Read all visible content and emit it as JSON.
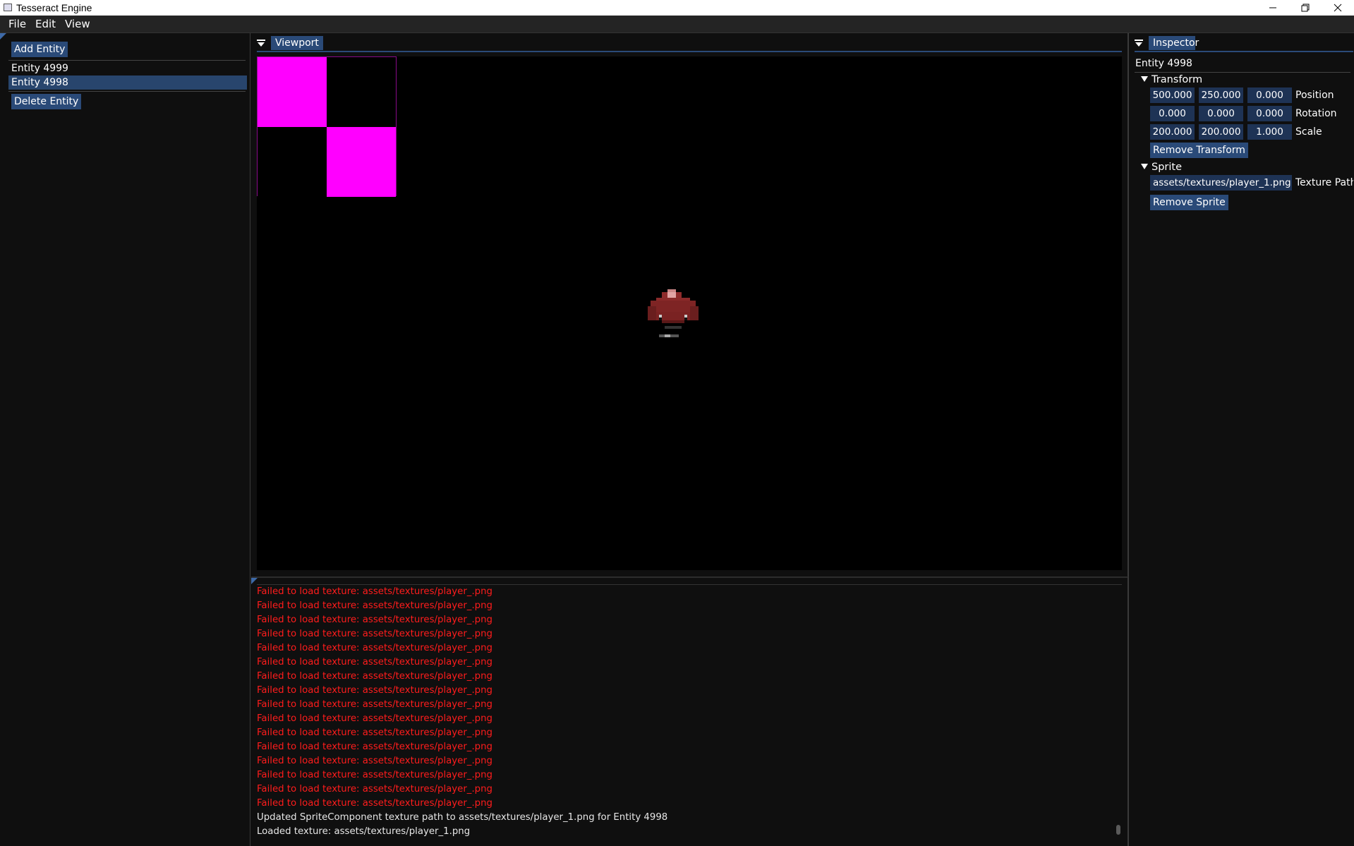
{
  "window": {
    "title": "Tesseract Engine",
    "controls": [
      "minimize",
      "maximize",
      "close"
    ]
  },
  "menubar": {
    "items": [
      "File",
      "Edit",
      "View"
    ]
  },
  "entities_panel": {
    "add_button": "Add Entity",
    "delete_button": "Delete Entity",
    "items": [
      {
        "label": "Entity 4999",
        "selected": false
      },
      {
        "label": "Entity 4998",
        "selected": true
      }
    ]
  },
  "viewport": {
    "title": "Viewport",
    "missing_texture_colors": [
      "#ff00ff",
      "#000000"
    ]
  },
  "console": {
    "lines": [
      {
        "type": "error",
        "text": "Failed to load texture: assets/textures/player_.png"
      },
      {
        "type": "error",
        "text": "Failed to load texture: assets/textures/player_.png"
      },
      {
        "type": "error",
        "text": "Failed to load texture: assets/textures/player_.png"
      },
      {
        "type": "error",
        "text": "Failed to load texture: assets/textures/player_.png"
      },
      {
        "type": "error",
        "text": "Failed to load texture: assets/textures/player_.png"
      },
      {
        "type": "error",
        "text": "Failed to load texture: assets/textures/player_.png"
      },
      {
        "type": "error",
        "text": "Failed to load texture: assets/textures/player_.png"
      },
      {
        "type": "error",
        "text": "Failed to load texture: assets/textures/player_.png"
      },
      {
        "type": "error",
        "text": "Failed to load texture: assets/textures/player_.png"
      },
      {
        "type": "error",
        "text": "Failed to load texture: assets/textures/player_.png"
      },
      {
        "type": "error",
        "text": "Failed to load texture: assets/textures/player_.png"
      },
      {
        "type": "error",
        "text": "Failed to load texture: assets/textures/player_.png"
      },
      {
        "type": "error",
        "text": "Failed to load texture: assets/textures/player_.png"
      },
      {
        "type": "error",
        "text": "Failed to load texture: assets/textures/player_.png"
      },
      {
        "type": "error",
        "text": "Failed to load texture: assets/textures/player_.png"
      },
      {
        "type": "error",
        "text": "Failed to load texture: assets/textures/player_.png"
      },
      {
        "type": "info",
        "text": "Updated SpriteComponent texture path to assets/textures/player_1.png for Entity 4998"
      },
      {
        "type": "info",
        "text": "Loaded texture: assets/textures/player_1.png"
      }
    ]
  },
  "inspector": {
    "title": "Inspector",
    "entity_name": "Entity 4998",
    "transform": {
      "header": "Transform",
      "position": {
        "label": "Position",
        "values": [
          "500.000",
          "250.000",
          "0.000"
        ]
      },
      "rotation": {
        "label": "Rotation",
        "values": [
          "0.000",
          "0.000",
          "0.000"
        ]
      },
      "scale": {
        "label": "Scale",
        "values": [
          "200.000",
          "200.000",
          "1.000"
        ]
      },
      "remove_button": "Remove Transform"
    },
    "sprite": {
      "header": "Sprite",
      "texture_path_value": "assets/textures/player_1.png",
      "texture_path_label": "Texture Path",
      "remove_button": "Remove Sprite"
    }
  },
  "colors": {
    "accent": "#2a4a78",
    "selected": "#28456d",
    "error_text": "#ff1c1c",
    "background": "#0f0f0f"
  }
}
